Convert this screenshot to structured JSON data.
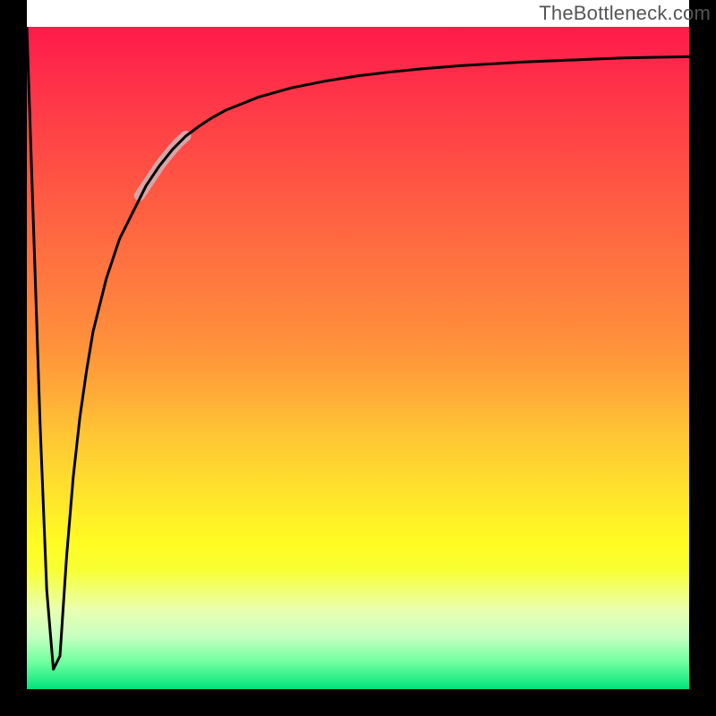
{
  "branding": {
    "watermark": "TheBottleneck.com"
  },
  "colors": {
    "gradient_top": "#ff1a4b",
    "gradient_mid": "#ffe82a",
    "gradient_bottom": "#00e37a",
    "curve": "#000000",
    "highlight": "#d7a4a7",
    "frame": "#000000"
  },
  "chart_data": {
    "type": "line",
    "title": "",
    "xlabel": "",
    "ylabel": "",
    "xlim": [
      0,
      100
    ],
    "ylim": [
      0,
      100
    ],
    "grid": false,
    "series": [
      {
        "name": "bottleneck-curve",
        "x": [
          0,
          1,
          2,
          3,
          4,
          5,
          6,
          7,
          8,
          9,
          10,
          12,
          14,
          16,
          18,
          20,
          22,
          24,
          26,
          28,
          30,
          35,
          40,
          45,
          50,
          55,
          60,
          65,
          70,
          75,
          80,
          85,
          90,
          95,
          100
        ],
        "values": [
          100,
          70,
          40,
          15,
          3,
          5,
          20,
          32,
          41,
          48,
          54,
          62,
          68,
          72,
          76,
          79,
          81.5,
          83.5,
          85,
          86.3,
          87.4,
          89.4,
          90.8,
          91.8,
          92.6,
          93.2,
          93.7,
          94.1,
          94.4,
          94.7,
          94.9,
          95.1,
          95.3,
          95.4,
          95.5
        ]
      },
      {
        "name": "highlight-segment",
        "x": [
          17,
          18,
          19,
          20,
          21,
          22,
          23,
          24
        ],
        "values": [
          74.5,
          76,
          77.5,
          79,
          80.3,
          81.5,
          82.6,
          83.5
        ]
      }
    ],
    "annotations": []
  }
}
